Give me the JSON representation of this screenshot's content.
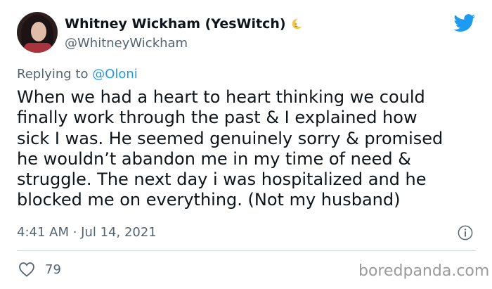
{
  "author": {
    "display_name": "Whitney Wickham (YesWitch)",
    "handle": "@WhitneyWickham",
    "name_emoji_icon": "crescent-moon-icon"
  },
  "platform_icon": "twitter-bird-icon",
  "reply": {
    "prefix": "Replying to",
    "mention": "@Oloni"
  },
  "tweet": {
    "lines": [
      "When we had a heart to heart thinking we could",
      "finally work through the past & I explained how",
      "sick I was. He seemed genuinely sorry & promised",
      "he wouldn’t abandon me in my time of need &",
      "struggle. The next day i was hospitalized and he",
      "blocked me on everything. (Not my husband)"
    ],
    "timestamp": "4:41 AM · Jul 14, 2021"
  },
  "stats": {
    "likes": "79"
  },
  "watermark": "boredpanda.com",
  "colors": {
    "twitter_blue": "#1d9bf0",
    "secondary_text": "#536471",
    "text": "#0f1419",
    "divider": "#cfd9de"
  }
}
